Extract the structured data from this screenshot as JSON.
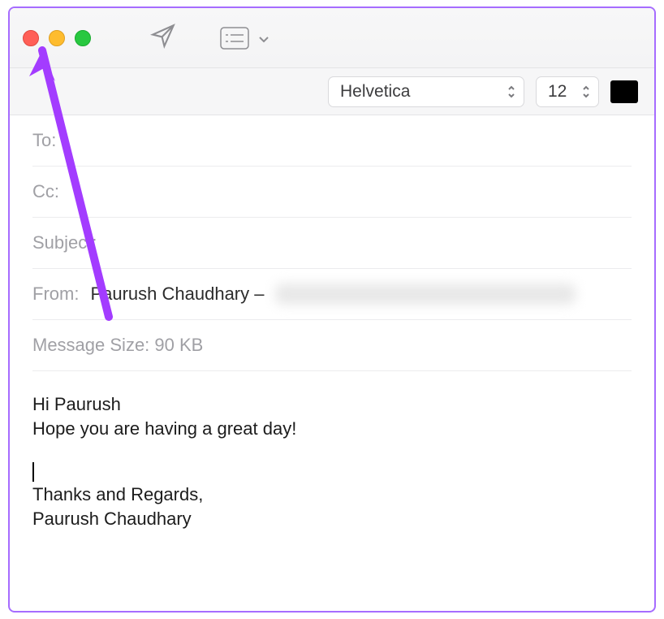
{
  "traffic_lights": {
    "close": "red",
    "minimize": "yellow",
    "zoom": "green"
  },
  "format": {
    "font": "Helvetica",
    "size": "12",
    "color": "#000000"
  },
  "headers": {
    "to_label": "To:",
    "cc_label": "Cc:",
    "subject_label": "Subject:",
    "from_label": "From:",
    "from_name": "Paurush Chaudhary –",
    "size_label": "Message Size: 90 KB"
  },
  "body": {
    "greeting": "Hi Paurush",
    "line2": "Hope you are having a great day!",
    "signoff1": "Thanks and Regards,",
    "signoff2": "Paurush Chaudhary"
  }
}
